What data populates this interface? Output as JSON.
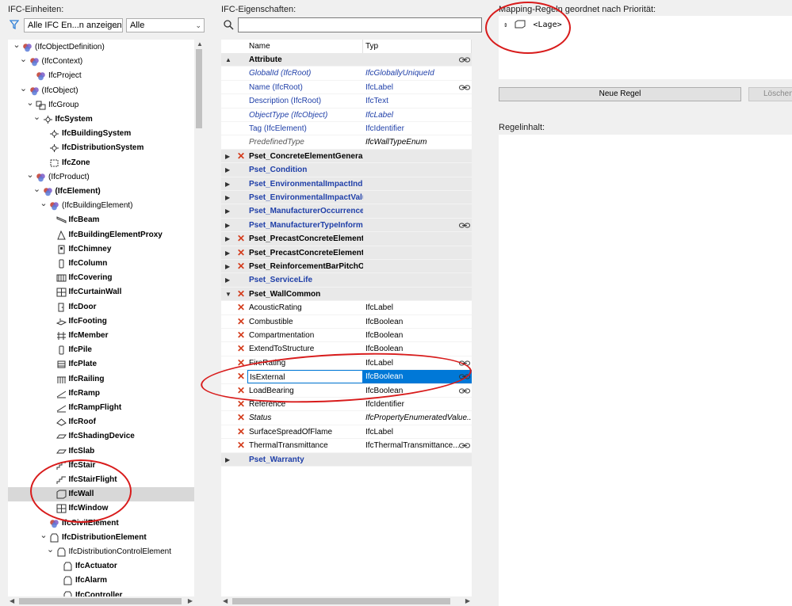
{
  "left_pane": {
    "title": "IFC-Einheiten:",
    "filter_select": "Alle IFC En...n anzeigen",
    "scope_select": "Alle",
    "tree": [
      {
        "label": "(IfcObjectDefinition)",
        "indent": 0,
        "exp": "v",
        "icon": "ifc-multi",
        "bold": false
      },
      {
        "label": "(IfcContext)",
        "indent": 1,
        "exp": "v",
        "icon": "ifc-multi",
        "bold": false
      },
      {
        "label": "IfcProject",
        "indent": 2,
        "exp": "",
        "icon": "ifc-multi",
        "bold": false
      },
      {
        "label": "(IfcObject)",
        "indent": 1,
        "exp": "v",
        "icon": "ifc-multi",
        "bold": false
      },
      {
        "label": "IfcGroup",
        "indent": 2,
        "exp": "v",
        "icon": "group",
        "bold": false
      },
      {
        "label": "IfcSystem",
        "indent": 3,
        "exp": "v",
        "icon": "system",
        "bold": true
      },
      {
        "label": "IfcBuildingSystem",
        "indent": 4,
        "exp": "",
        "icon": "system",
        "bold": true
      },
      {
        "label": "IfcDistributionSystem",
        "indent": 4,
        "exp": "",
        "icon": "system",
        "bold": true
      },
      {
        "label": "IfcZone",
        "indent": 4,
        "exp": "",
        "icon": "zone",
        "bold": true
      },
      {
        "label": "(IfcProduct)",
        "indent": 2,
        "exp": "v",
        "icon": "ifc-multi",
        "bold": false
      },
      {
        "label": "(IfcElement)",
        "indent": 3,
        "exp": "v",
        "icon": "ifc-multi",
        "bold": true
      },
      {
        "label": "(IfcBuildingElement)",
        "indent": 4,
        "exp": "v",
        "icon": "ifc-multi",
        "bold": false
      },
      {
        "label": "IfcBeam",
        "indent": 5,
        "exp": "",
        "icon": "beam",
        "bold": true
      },
      {
        "label": "IfcBuildingElementProxy",
        "indent": 5,
        "exp": "",
        "icon": "proxy",
        "bold": true
      },
      {
        "label": "IfcChimney",
        "indent": 5,
        "exp": "",
        "icon": "chimney",
        "bold": true
      },
      {
        "label": "IfcColumn",
        "indent": 5,
        "exp": "",
        "icon": "column",
        "bold": true
      },
      {
        "label": "IfcCovering",
        "indent": 5,
        "exp": "",
        "icon": "covering",
        "bold": true
      },
      {
        "label": "IfcCurtainWall",
        "indent": 5,
        "exp": "",
        "icon": "curtainwall",
        "bold": true
      },
      {
        "label": "IfcDoor",
        "indent": 5,
        "exp": "",
        "icon": "door",
        "bold": true
      },
      {
        "label": "IfcFooting",
        "indent": 5,
        "exp": "",
        "icon": "footing",
        "bold": true
      },
      {
        "label": "IfcMember",
        "indent": 5,
        "exp": "",
        "icon": "member",
        "bold": true
      },
      {
        "label": "IfcPile",
        "indent": 5,
        "exp": "",
        "icon": "column",
        "bold": true
      },
      {
        "label": "IfcPlate",
        "indent": 5,
        "exp": "",
        "icon": "plate",
        "bold": true
      },
      {
        "label": "IfcRailing",
        "indent": 5,
        "exp": "",
        "icon": "railing",
        "bold": true
      },
      {
        "label": "IfcRamp",
        "indent": 5,
        "exp": "",
        "icon": "ramp",
        "bold": true
      },
      {
        "label": "IfcRampFlight",
        "indent": 5,
        "exp": "",
        "icon": "ramp",
        "bold": true
      },
      {
        "label": "IfcRoof",
        "indent": 5,
        "exp": "",
        "icon": "roof",
        "bold": true
      },
      {
        "label": "IfcShadingDevice",
        "indent": 5,
        "exp": "",
        "icon": "slab",
        "bold": true
      },
      {
        "label": "IfcSlab",
        "indent": 5,
        "exp": "",
        "icon": "slab",
        "bold": true
      },
      {
        "label": "IfcStair",
        "indent": 5,
        "exp": "",
        "icon": "stair",
        "bold": true
      },
      {
        "label": "IfcStairFlight",
        "indent": 5,
        "exp": "",
        "icon": "stair",
        "bold": true
      },
      {
        "label": "IfcWall",
        "indent": 5,
        "exp": "",
        "icon": "wall",
        "bold": true,
        "selected": true
      },
      {
        "label": "IfcWindow",
        "indent": 5,
        "exp": "",
        "icon": "window",
        "bold": true
      },
      {
        "label": "IfcCivilElement",
        "indent": 4,
        "exp": "",
        "icon": "ifc-multi",
        "bold": true
      },
      {
        "label": "IfcDistributionElement",
        "indent": 4,
        "exp": "v",
        "icon": "dist",
        "bold": true
      },
      {
        "label": "IfcDistributionControlElement",
        "indent": 5,
        "exp": "v",
        "icon": "dist",
        "bold": false
      },
      {
        "label": "IfcActuator",
        "indent": 6,
        "exp": "",
        "icon": "dist",
        "bold": true
      },
      {
        "label": "IfcAlarm",
        "indent": 6,
        "exp": "",
        "icon": "dist",
        "bold": true
      },
      {
        "label": "IfcController",
        "indent": 6,
        "exp": "",
        "icon": "dist",
        "bold": true
      }
    ]
  },
  "middle_pane": {
    "title": "IFC-Eigenschaften:",
    "search_placeholder": "",
    "columns": [
      "Name",
      "Typ"
    ],
    "rows": [
      {
        "name": "Attribute",
        "type": "",
        "group": true,
        "exp": "▲",
        "del": false,
        "nstyle": "bold",
        "tstyle": "",
        "link": true
      },
      {
        "name": "GlobalId (IfcRoot)",
        "type": "IfcGloballyUniqueId",
        "group": false,
        "exp": "",
        "del": false,
        "nstyle": "blue italic",
        "tstyle": "blue italic",
        "link": false
      },
      {
        "name": "Name (IfcRoot)",
        "type": "IfcLabel",
        "group": false,
        "exp": "",
        "del": false,
        "nstyle": "blue",
        "tstyle": "blue",
        "link": true
      },
      {
        "name": "Description (IfcRoot)",
        "type": "IfcText",
        "group": false,
        "exp": "",
        "del": false,
        "nstyle": "blue",
        "tstyle": "blue",
        "link": false
      },
      {
        "name": "ObjectType (IfcObject)",
        "type": "IfcLabel",
        "group": false,
        "exp": "",
        "del": false,
        "nstyle": "blue italic",
        "tstyle": "blue italic",
        "link": false
      },
      {
        "name": "Tag (IfcElement)",
        "type": "IfcIdentifier",
        "group": false,
        "exp": "",
        "del": false,
        "nstyle": "blue",
        "tstyle": "blue",
        "link": false
      },
      {
        "name": "PredefinedType",
        "type": "IfcWallTypeEnum",
        "group": false,
        "exp": "",
        "del": false,
        "nstyle": "gray italic",
        "tstyle": "italic",
        "link": false
      },
      {
        "name": "Pset_ConcreteElementGeneral",
        "type": "",
        "group": true,
        "exp": "▶",
        "del": true,
        "nstyle": "bold",
        "tstyle": "",
        "link": false
      },
      {
        "name": "Pset_Condition",
        "type": "",
        "group": true,
        "exp": "▶",
        "del": false,
        "nstyle": "bold blue",
        "tstyle": "",
        "link": false
      },
      {
        "name": "Pset_EnvironmentalImpactIndic...",
        "type": "",
        "group": true,
        "exp": "▶",
        "del": false,
        "nstyle": "bold blue",
        "tstyle": "",
        "link": false
      },
      {
        "name": "Pset_EnvironmentalImpactValues",
        "type": "",
        "group": true,
        "exp": "▶",
        "del": false,
        "nstyle": "bold blue",
        "tstyle": "",
        "link": false
      },
      {
        "name": "Pset_ManufacturerOccurrence",
        "type": "",
        "group": true,
        "exp": "▶",
        "del": false,
        "nstyle": "bold blue",
        "tstyle": "",
        "link": false
      },
      {
        "name": "Pset_ManufacturerTypeInforma...",
        "type": "",
        "group": true,
        "exp": "▶",
        "del": false,
        "nstyle": "bold blue",
        "tstyle": "",
        "link": true
      },
      {
        "name": "Pset_PrecastConcreteElementFa...",
        "type": "",
        "group": true,
        "exp": "▶",
        "del": true,
        "nstyle": "bold",
        "tstyle": "",
        "link": false
      },
      {
        "name": "Pset_PrecastConcreteElementG...",
        "type": "",
        "group": true,
        "exp": "▶",
        "del": true,
        "nstyle": "bold",
        "tstyle": "",
        "link": false
      },
      {
        "name": "Pset_ReinforcementBarPitchOf...",
        "type": "",
        "group": true,
        "exp": "▶",
        "del": true,
        "nstyle": "bold",
        "tstyle": "",
        "link": false
      },
      {
        "name": "Pset_ServiceLife",
        "type": "",
        "group": true,
        "exp": "▶",
        "del": false,
        "nstyle": "bold blue",
        "tstyle": "",
        "link": false
      },
      {
        "name": "Pset_WallCommon",
        "type": "",
        "group": true,
        "exp": "▼",
        "del": true,
        "nstyle": "bold",
        "tstyle": "",
        "link": false
      },
      {
        "name": "AcousticRating",
        "type": "IfcLabel",
        "group": false,
        "exp": "",
        "del": true,
        "nstyle": "",
        "tstyle": "",
        "link": false
      },
      {
        "name": "Combustible",
        "type": "IfcBoolean",
        "group": false,
        "exp": "",
        "del": true,
        "nstyle": "",
        "tstyle": "",
        "link": false
      },
      {
        "name": "Compartmentation",
        "type": "IfcBoolean",
        "group": false,
        "exp": "",
        "del": true,
        "nstyle": "",
        "tstyle": "",
        "link": false
      },
      {
        "name": "ExtendToStructure",
        "type": "IfcBoolean",
        "group": false,
        "exp": "",
        "del": true,
        "nstyle": "",
        "tstyle": "",
        "link": false
      },
      {
        "name": "FireRating",
        "type": "IfcLabel",
        "group": false,
        "exp": "",
        "del": true,
        "nstyle": "",
        "tstyle": "",
        "link": true
      },
      {
        "name": "IsExternal",
        "type": "IfcBoolean",
        "group": false,
        "exp": "",
        "del": true,
        "nstyle": "",
        "tstyle": "",
        "link": true,
        "selected": true
      },
      {
        "name": "LoadBearing",
        "type": "IfcBoolean",
        "group": false,
        "exp": "",
        "del": true,
        "nstyle": "",
        "tstyle": "",
        "link": true
      },
      {
        "name": "Reference",
        "type": "IfcIdentifier",
        "group": false,
        "exp": "",
        "del": true,
        "nstyle": "",
        "tstyle": "",
        "link": false
      },
      {
        "name": "Status",
        "type": "IfcPropertyEnumeratedValue...",
        "group": false,
        "exp": "",
        "del": true,
        "nstyle": "italic",
        "tstyle": "italic",
        "link": false
      },
      {
        "name": "SurfaceSpreadOfFlame",
        "type": "IfcLabel",
        "group": false,
        "exp": "",
        "del": true,
        "nstyle": "",
        "tstyle": "",
        "link": false
      },
      {
        "name": "ThermalTransmittance",
        "type": "IfcThermalTransmittance...",
        "group": false,
        "exp": "",
        "del": true,
        "nstyle": "",
        "tstyle": "",
        "link": true
      },
      {
        "name": "Pset_Warranty",
        "type": "",
        "group": true,
        "exp": "▶",
        "del": false,
        "nstyle": "bold blue",
        "tstyle": "",
        "link": false
      }
    ]
  },
  "right_pane": {
    "title": "Mapping-Regeln geordnet nach Priorität:",
    "rule": "<Lage>",
    "new_rule_button": "Neue Regel",
    "delete_button": "Löschen",
    "content_title": "Regelinhalt:"
  },
  "colors": {
    "accent": "#0078d7",
    "delete": "#d33a1a",
    "annotation": "#d81b1b",
    "link_blue": "#1f3fa8"
  }
}
